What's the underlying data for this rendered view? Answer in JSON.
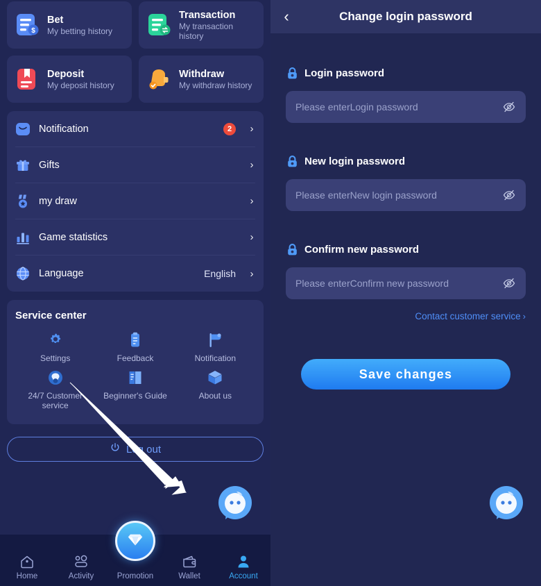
{
  "left": {
    "quick_cards": [
      {
        "title": "Bet",
        "subtitle": "My betting history",
        "icon": "bet-doc-icon",
        "color": "#4a82f3"
      },
      {
        "title": "Transaction",
        "subtitle": "My transaction history",
        "icon": "transaction-doc-icon",
        "color": "#2bd49a"
      },
      {
        "title": "Deposit",
        "subtitle": "My deposit history",
        "icon": "deposit-book-icon",
        "color": "#ef4a56"
      },
      {
        "title": "Withdraw",
        "subtitle": "My withdraw history",
        "icon": "withdraw-wallet-icon",
        "color": "#f5a833"
      }
    ],
    "menu": [
      {
        "label": "Notification",
        "icon": "envelope-icon",
        "badge": "2",
        "value": ""
      },
      {
        "label": "Gifts",
        "icon": "gift-icon",
        "badge": "",
        "value": ""
      },
      {
        "label": "my draw",
        "icon": "medal-icon",
        "badge": "",
        "value": ""
      },
      {
        "label": "Game statistics",
        "icon": "bar-chart-icon",
        "badge": "",
        "value": ""
      },
      {
        "label": "Language",
        "icon": "globe-icon",
        "badge": "",
        "value": "English"
      }
    ],
    "service_center": {
      "title": "Service center",
      "items": [
        {
          "label": "Settings",
          "icon": "gear-icon"
        },
        {
          "label": "Feedback",
          "icon": "clipboard-icon"
        },
        {
          "label": "Notification",
          "icon": "megaphone-icon"
        },
        {
          "label": "24/7 Customer service",
          "icon": "headset-icon"
        },
        {
          "label": "Beginner's Guide",
          "icon": "book-icon"
        },
        {
          "label": "About us",
          "icon": "cube-icon"
        }
      ]
    },
    "logout_label": "Log out",
    "bottom_nav": [
      {
        "label": "Home",
        "icon": "home-icon",
        "active": false
      },
      {
        "label": "Activity",
        "icon": "activity-icon",
        "active": false
      },
      {
        "label": "Promotion",
        "icon": "diamond-icon",
        "active": false
      },
      {
        "label": "Wallet",
        "icon": "wallet-icon",
        "active": false
      },
      {
        "label": "Account",
        "icon": "account-icon",
        "active": true
      }
    ]
  },
  "right": {
    "header": {
      "title": "Change login password",
      "back_icon": "chevron-left-icon"
    },
    "fields": [
      {
        "label": "Login password",
        "placeholder": "Please enterLogin password",
        "value": ""
      },
      {
        "label": "New login password",
        "placeholder": "Please enterNew login password",
        "value": ""
      },
      {
        "label": "Confirm new password",
        "placeholder": "Please enterConfirm new password",
        "value": ""
      }
    ],
    "contact_link": "Contact customer service",
    "save_label": "Save changes"
  },
  "colors": {
    "accent": "#2a7ff0",
    "badge_red": "#ee4b3b",
    "link_blue": "#4f8ef7",
    "active_nav": "#39a9f4"
  }
}
